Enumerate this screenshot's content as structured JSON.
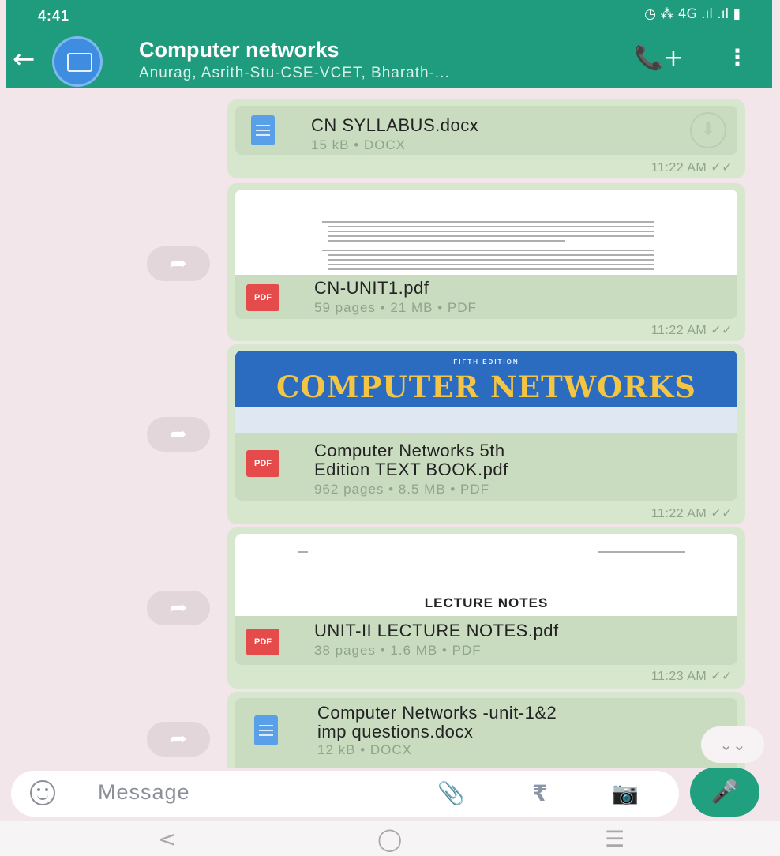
{
  "status": {
    "time": "4:41",
    "icons": "◷ ⁂ 4G .ıl .ıl ▮"
  },
  "header": {
    "back_icon": "←",
    "title": "Computer networks",
    "subtitle": "Anurag, Asrith-Stu-CSE-VCET, Bharath-...",
    "call_icon": "📞+",
    "more_icon": "⋮"
  },
  "messages": [
    {
      "type": "docx",
      "name": "CN SYLLABUS.docx",
      "meta": "15 kB • DOCX",
      "time": "11:22 AM ✓✓",
      "download_icon": "⬇"
    },
    {
      "type": "pdf",
      "name": "CN-UNIT1.pdf",
      "meta": "59 pages • 21 MB • PDF",
      "time": "11:22 AM ✓✓",
      "badge": "PDF"
    },
    {
      "type": "pdf",
      "cover_edition": "FIFTH EDITION",
      "cover_title": "COMPUTER NETWORKS",
      "name1": "Computer Networks 5th",
      "name2": "Edition TEXT BOOK.pdf",
      "meta": "962 pages • 8.5 MB • PDF",
      "time": "11:22 AM ✓✓",
      "badge": "PDF"
    },
    {
      "type": "pdf",
      "preview_text": "LECTURE NOTES",
      "name": "UNIT-II LECTURE NOTES.pdf",
      "meta": "38 pages • 1.6 MB • PDF",
      "time": "11:23 AM ✓✓",
      "badge": "PDF"
    },
    {
      "type": "docx",
      "name1": "Computer Networks -unit-1&2",
      "name2": "imp questions.docx",
      "meta": "12 kB • DOCX"
    }
  ],
  "forward_icon": "➦",
  "scroll_down_icon": "⌄⌄",
  "input": {
    "placeholder": "Message",
    "attach_icon": "📎",
    "rupee_icon": "₹",
    "camera_icon": "📷",
    "mic_icon": "🎤"
  },
  "nav": {
    "back": "<",
    "home": "◯",
    "recents": "☰"
  }
}
